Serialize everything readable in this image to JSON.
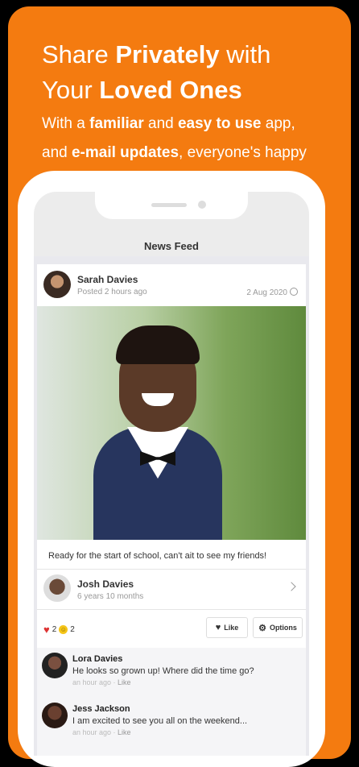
{
  "promo": {
    "line1_pre": "Share ",
    "line1_bold": "Privately",
    "line1_post": " with",
    "line2_pre": "Your ",
    "line2_bold": "Loved Ones",
    "sub1_pre": "With a ",
    "sub1_bold1": "familiar",
    "sub1_mid": " and ",
    "sub1_bold2": "easy to use",
    "sub1_post": " app,",
    "sub2_pre": "and ",
    "sub2_bold": "e-mail updates",
    "sub2_post": ", everyone's happy"
  },
  "screen": {
    "title": "News Feed"
  },
  "post": {
    "author": "Sarah Davies",
    "posted": "Posted 2 hours ago",
    "date": "2 Aug 2020",
    "caption": "Ready for the start of school, can't ait to see my friends!",
    "child_name": "Josh Davies",
    "child_age": "6 years 10 months",
    "heart_count": "2",
    "smile_count": "2",
    "like_label": "Like",
    "options_label": "Options"
  },
  "comments": [
    {
      "name": "Lora Davies",
      "text": "He looks so grown up! Where did the time go?",
      "time": "an hour ago",
      "like": "Like"
    },
    {
      "name": "Jess Jackson",
      "text": "I am excited to see you all on the weekend...",
      "time": "an hour ago",
      "like": "Like"
    }
  ],
  "colors": {
    "brand_orange": "#f47b10",
    "background": "#000000"
  }
}
